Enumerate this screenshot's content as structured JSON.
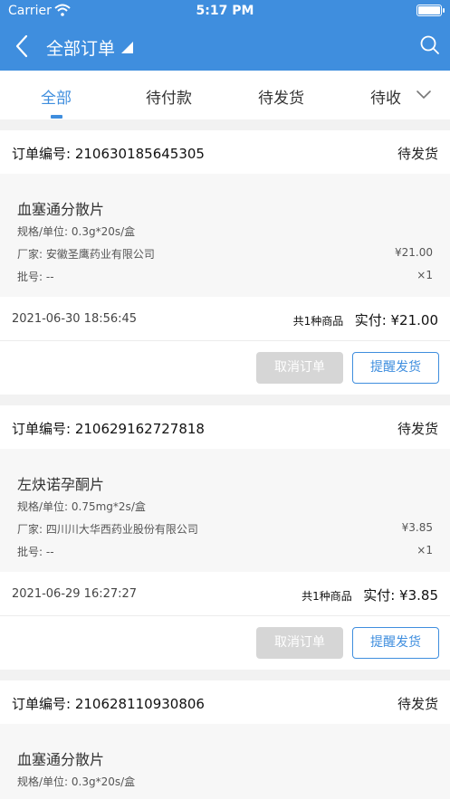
{
  "status_bar": {
    "carrier": "Carrier",
    "time": "5:17 PM"
  },
  "header": {
    "title": "全部订单"
  },
  "tabs": [
    {
      "label": "全部",
      "active": true
    },
    {
      "label": "待付款",
      "active": false
    },
    {
      "label": "待发货",
      "active": false
    },
    {
      "label": "待收",
      "active": false
    }
  ],
  "orders": [
    {
      "order_no": "订单编号: 210630185645305",
      "status": "待发货",
      "product_name": "血塞通分散片",
      "spec": "规格/单位: 0.3g*20s/盒",
      "maker": "厂家: 安徽圣鹰药业有限公司",
      "batch": "批号: --",
      "price": "¥21.00",
      "qty": "×1",
      "date": "2021-06-30 18:56:45",
      "count": "共1种商品",
      "paid": "实付: ¥21.00",
      "cancel_label": "取消订单",
      "remind_label": "提醒发货"
    },
    {
      "order_no": "订单编号: 210629162727818",
      "status": "待发货",
      "product_name": "左炔诺孕酮片",
      "spec": "规格/单位: 0.75mg*2s/盒",
      "maker": "厂家: 四川川大华西药业股份有限公司",
      "batch": "批号: --",
      "price": "¥3.85",
      "qty": "×1",
      "date": "2021-06-29 16:27:27",
      "count": "共1种商品",
      "paid": "实付: ¥3.85",
      "cancel_label": "取消订单",
      "remind_label": "提醒发货"
    },
    {
      "order_no": "订单编号: 210628110930806",
      "status": "待发货",
      "product_name": "血塞通分散片",
      "spec": "规格/单位: 0.3g*20s/盒"
    }
  ],
  "colors": {
    "primary": "#3f8ede",
    "background": "#f2f2f2",
    "disabled": "#d6d6d6"
  },
  "icons": [
    "back-icon",
    "dropdown-caret-icon",
    "search-icon",
    "chevron-down-icon",
    "wifi-icon",
    "battery-icon"
  ]
}
